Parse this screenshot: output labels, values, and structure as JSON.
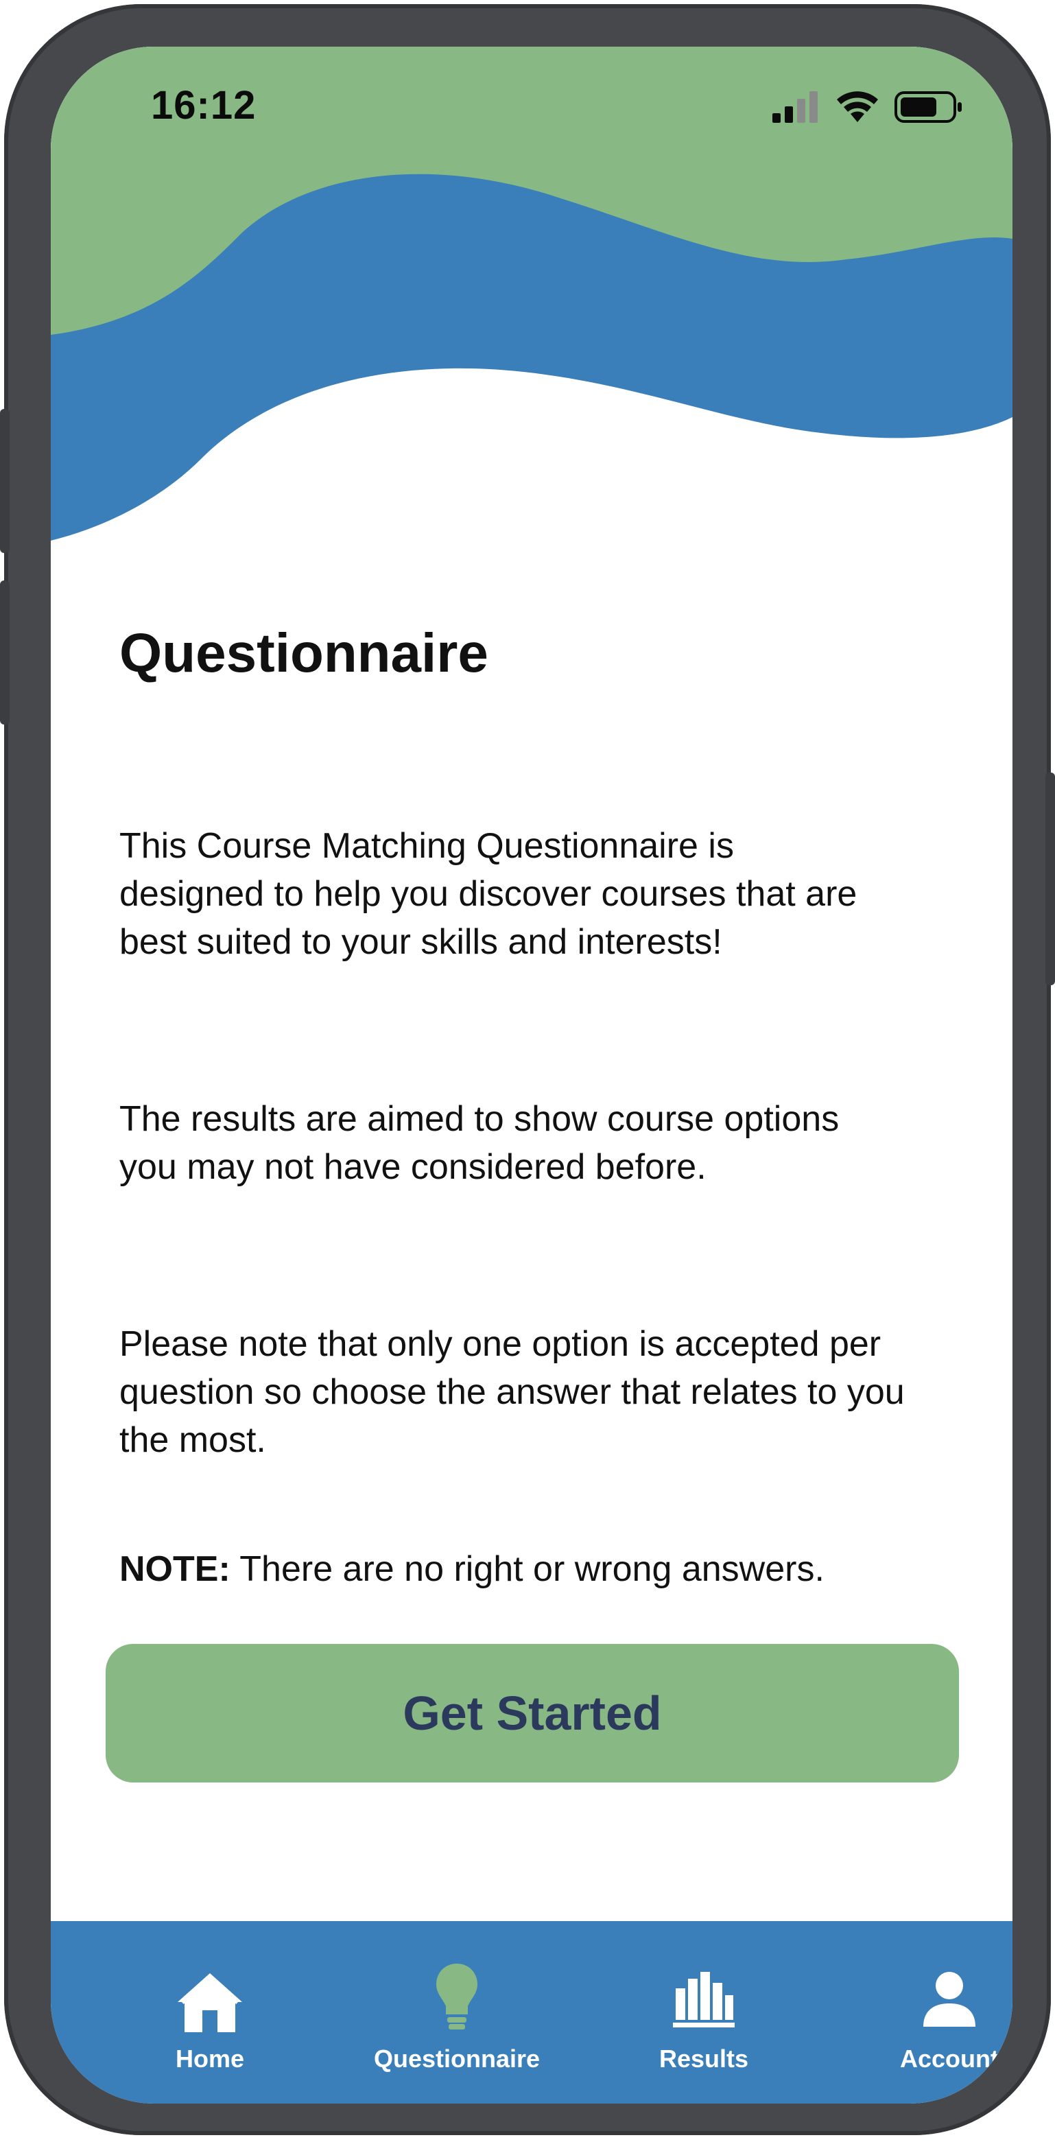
{
  "status_bar": {
    "time": "16:12"
  },
  "page": {
    "title": "Questionnaire",
    "paragraphs": [
      "This Course Matching Questionnaire is designed to help you discover courses that are best suited to your skills and interests!",
      "The results are aimed to show course options you may not have considered before.",
      "Please note that only one option is accepted per question so choose the answer that relates to you the most."
    ],
    "note_label": "NOTE:",
    "note_text": " There are no right or wrong answers.",
    "cta_label": "Get Started"
  },
  "tab_bar": {
    "items": [
      {
        "label": "Home",
        "icon": "house-icon",
        "active": false
      },
      {
        "label": "Questionnaire",
        "icon": "lightbulb-icon",
        "active": true
      },
      {
        "label": "Results",
        "icon": "bar-chart-icon",
        "active": false
      },
      {
        "label": "Account",
        "icon": "person-icon",
        "active": false
      }
    ]
  },
  "colors": {
    "header_green": "#88b884",
    "header_blue": "#3a7fb9",
    "tab_bar_bg": "#3a7fb9",
    "active_tab_icon": "#88b884",
    "button_bg": "#88b884",
    "button_text": "#2b3a5c",
    "phone_frame": "#47484c"
  }
}
